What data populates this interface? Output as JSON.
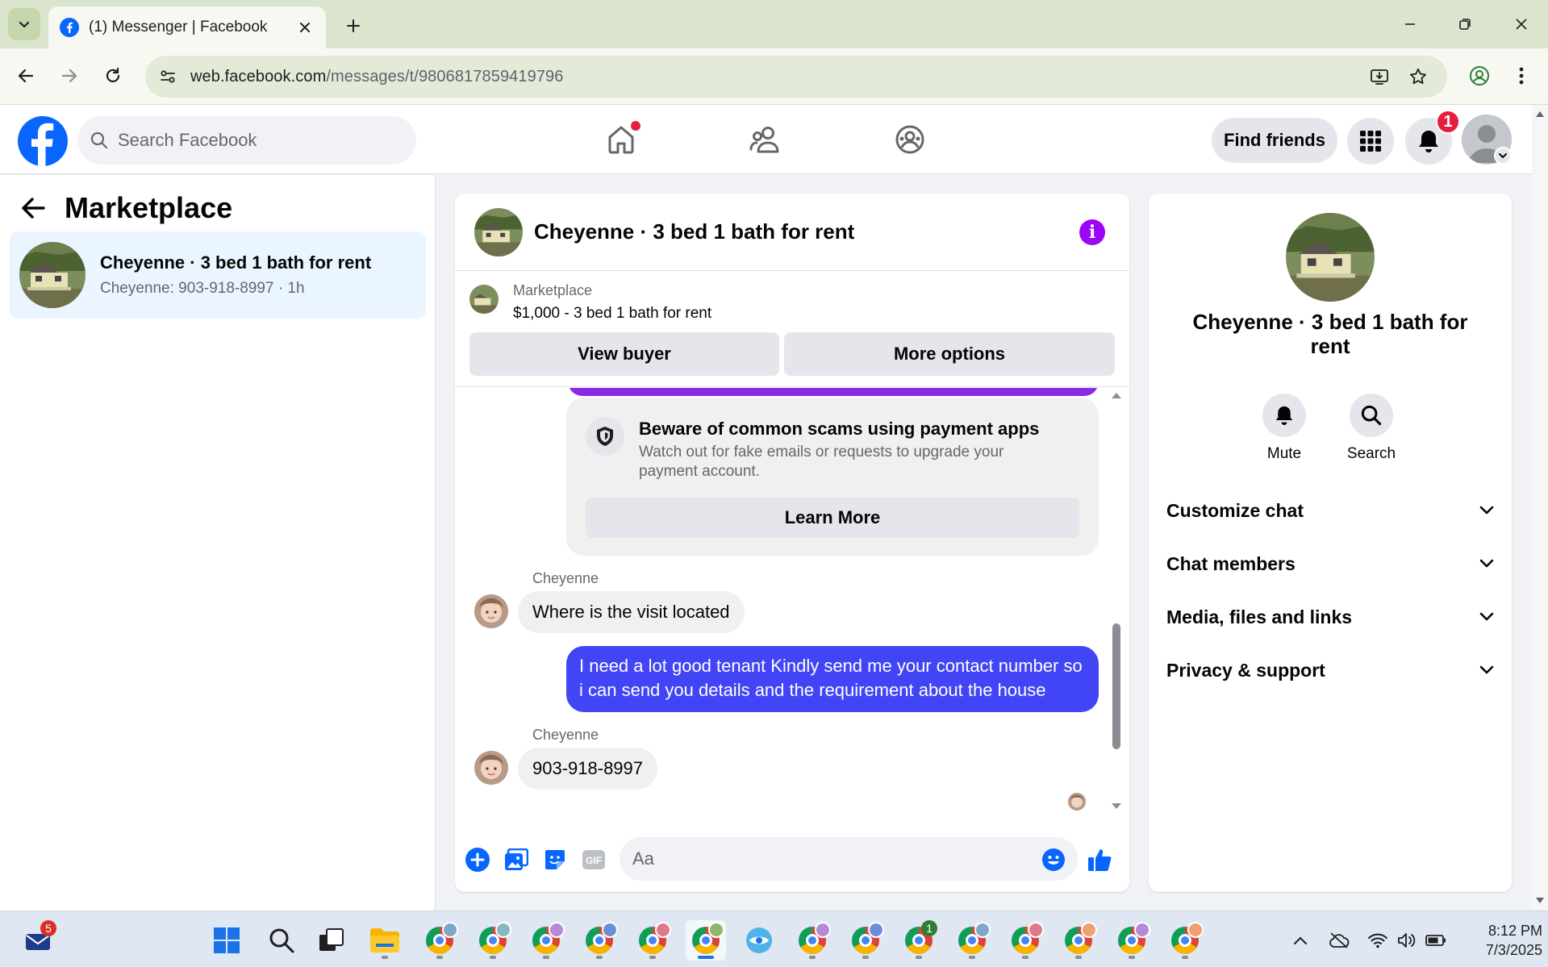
{
  "browser": {
    "tab_title": "(1) Messenger | Facebook",
    "url_host": "web.facebook.com",
    "url_path": "/messages/t/9806817859419796"
  },
  "fb_header": {
    "search_placeholder": "Search Facebook",
    "find_friends_label": "Find friends",
    "notification_count": "1"
  },
  "sidebar": {
    "title": "Marketplace",
    "conversations": [
      {
        "name": "Cheyenne · 3 bed 1 bath for rent",
        "snippet": "Cheyenne: 903-918-8997 · 1h"
      }
    ]
  },
  "chat": {
    "title": "Cheyenne · 3 bed 1 bath for rent",
    "listing": {
      "source": "Marketplace",
      "price_title": "$1,000 - 3 bed 1 bath for rent",
      "view_buyer_label": "View buyer",
      "more_options_label": "More options"
    },
    "scam_notice": {
      "title": "Beware of common scams using payment apps",
      "body": "Watch out for fake emails or requests to upgrade your payment account.",
      "button_label": "Learn More"
    },
    "messages": [
      {
        "sender": "Cheyenne",
        "text": "Where is the visit located",
        "direction": "incoming"
      },
      {
        "sender": "",
        "text": "I need a lot good tenant Kindly send me your contact number so i can send you details and the requirement about the house",
        "direction": "outgoing"
      },
      {
        "sender": "Cheyenne",
        "text": "903-918-8997",
        "direction": "incoming"
      }
    ],
    "composer_placeholder": "Aa"
  },
  "details_panel": {
    "title": "Cheyenne · 3 bed 1 bath for rent",
    "actions": [
      {
        "label": "Mute",
        "icon": "bell-icon"
      },
      {
        "label": "Search",
        "icon": "search-icon"
      }
    ],
    "sections": [
      {
        "label": "Customize chat"
      },
      {
        "label": "Chat members"
      },
      {
        "label": "Media, files and links"
      },
      {
        "label": "Privacy & support"
      }
    ]
  },
  "taskbar": {
    "mail_badge": "5",
    "chrome_badge": "1",
    "time": "8:12 PM",
    "date": "7/3/2025"
  },
  "colors": {
    "facebook_blue": "#0866ff",
    "messenger_outgoing": "#4245f5",
    "info_purple": "#9d05f5",
    "notification_red": "#e41e3f",
    "selected_conversation": "#ebf5ff"
  }
}
